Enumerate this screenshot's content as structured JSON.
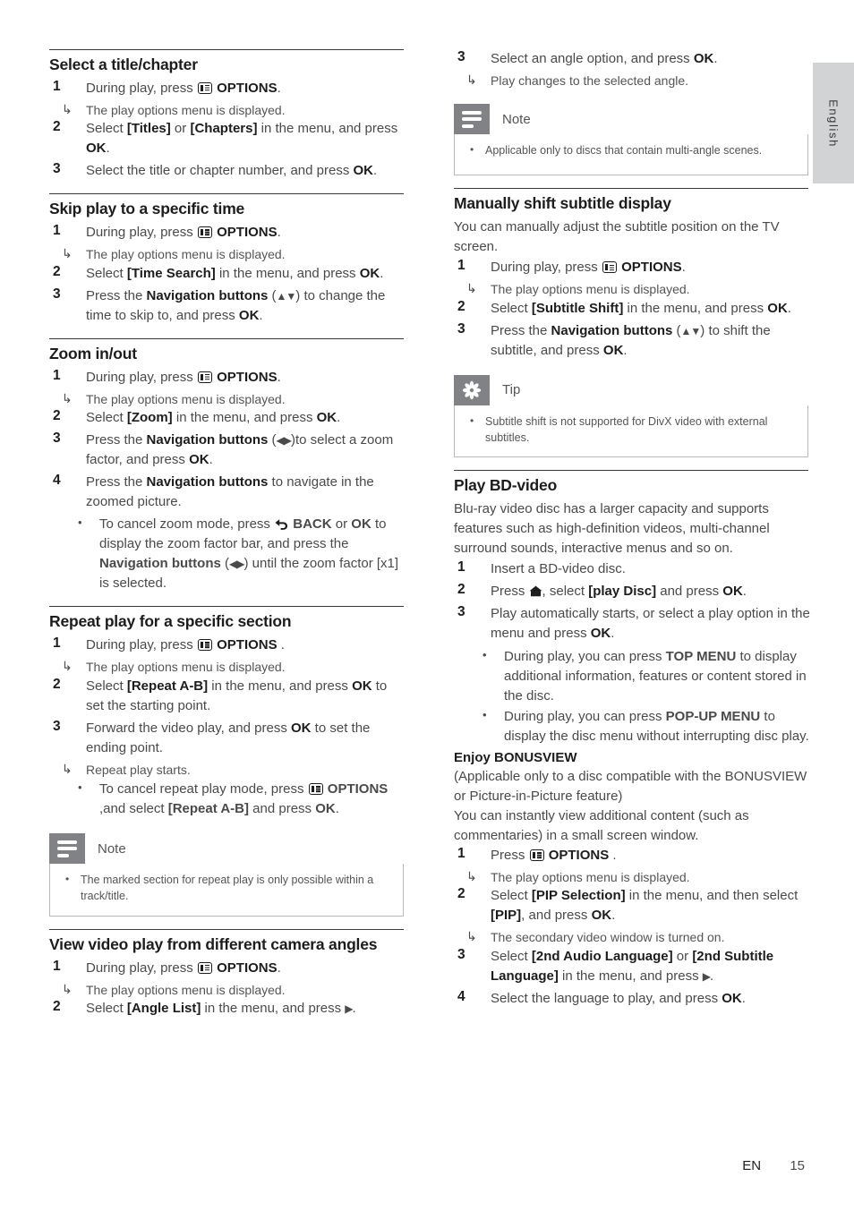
{
  "page": {
    "language_tab": "English",
    "footer": {
      "language_code": "EN",
      "page_number": "15"
    }
  },
  "icons": {
    "options": "options-icon",
    "back": "back-arrow-icon",
    "home": "home-icon",
    "note": "note-icon",
    "tip": "tip-star-icon",
    "nav_up_down": "▲▼",
    "nav_left_right": "◀▶",
    "right_triangle": "▶",
    "result_arrow": "↳",
    "bullet": "•"
  },
  "left_column": {
    "sections": [
      {
        "title": "Select a title/chapter",
        "steps": [
          {
            "num": "1",
            "text_html": "During play, press <span class=\"ico ico-options\" data-name=\"options-icon\" data-interactable=\"false\"></span> <b>OPTIONS</b>.",
            "result": "The play options menu is displayed."
          },
          {
            "num": "2",
            "text_html": "Select <b>[Titles]</b> or <b>[Chapters]</b> in the menu, and press <b>OK</b>."
          },
          {
            "num": "3",
            "text_html": "Select the title or chapter number, and press <b>OK</b>."
          }
        ]
      },
      {
        "title": "Skip play to a specific time",
        "steps": [
          {
            "num": "1",
            "text_html": "During play, press <span class=\"ico ico-options\" data-name=\"options-icon\" data-interactable=\"false\"></span> <b>OPTIONS</b>.",
            "result": "The play options menu is displayed."
          },
          {
            "num": "2",
            "text_html": "Select <b>[Time Search]</b> in the menu, and press <b>OK</b>."
          },
          {
            "num": "3",
            "text_html": "Press the <b>Navigation buttons</b> (<span class=\"ico-tri\">▲▼</span>) to change the time to skip to, and press <b>OK</b>."
          }
        ]
      },
      {
        "title": "Zoom in/out",
        "steps": [
          {
            "num": "1",
            "text_html": "During play, press <span class=\"ico ico-options\" data-name=\"options-icon\" data-interactable=\"false\"></span> <b>OPTIONS</b>.",
            "result": "The play options menu is displayed."
          },
          {
            "num": "2",
            "text_html": "Select <b>[Zoom]</b> in the menu, and press <b>OK</b>."
          },
          {
            "num": "3",
            "text_html": "Press the <b>Navigation buttons</b> (<span class=\"ico-tri\">◀▶</span>)to select a zoom factor, and press <b>OK</b>."
          },
          {
            "num": "4",
            "text_html": "Press the <b>Navigation buttons</b> to navigate in the zoomed picture.",
            "bullets": [
              "To cancel zoom mode, press <span class=\"ico-back\" data-name=\"back-arrow-icon\"></span> <b>BACK</b> or <b>OK</b> to display the zoom factor bar, and press the <b>Navigation buttons</b> (<span class=\"ico-tri\">◀▶</span>) until the zoom factor [x1] is selected."
            ]
          }
        ]
      },
      {
        "title": "Repeat play for a specific section",
        "steps": [
          {
            "num": "1",
            "text_html": "During play, press <span class=\"ico ico-options\" data-name=\"options-icon\" data-interactable=\"false\"></span> <b>OPTIONS</b> .",
            "result": "The play options menu is displayed."
          },
          {
            "num": "2",
            "text_html": "Select <b>[Repeat A-B]</b> in the menu, and press <b>OK</b> to set the starting point."
          },
          {
            "num": "3",
            "text_html": "Forward the video play, and press <b>OK</b> to set the ending point.",
            "result": "Repeat play starts.",
            "bullets": [
              "To cancel repeat play mode, press <span class=\"ico ico-options\"></span> <b>OPTIONS</b> ,and select <b>[Repeat A-B]</b> and press <b>OK</b>."
            ]
          }
        ],
        "callout": {
          "type": "note",
          "label": "Note",
          "items": [
            "The marked section for repeat play is only possible within a track/title."
          ]
        }
      },
      {
        "title": "View video play from different camera angles",
        "steps": [
          {
            "num": "1",
            "text_html": "During play, press <span class=\"ico ico-options\" data-name=\"options-icon\" data-interactable=\"false\"></span> <b>OPTIONS</b>.",
            "result": "The play options menu is displayed."
          },
          {
            "num": "2",
            "text_html": "Select <b>[Angle List]</b> in the menu, and press <span class=\"ico-tri\">▶</span>."
          }
        ]
      }
    ]
  },
  "right_column": {
    "continued_steps": [
      {
        "num": "3",
        "text_html": "Select an angle option, and press <b>OK</b>.",
        "result": "Play changes to the selected angle."
      }
    ],
    "continued_callout": {
      "type": "note",
      "label": "Note",
      "items": [
        "Applicable only to discs that contain multi-angle scenes."
      ]
    },
    "sections": [
      {
        "title": "Manually shift subtitle display",
        "intro": "You can manually adjust the subtitle position on the TV screen.",
        "steps": [
          {
            "num": "1",
            "text_html": "During play, press <span class=\"ico ico-options\" data-name=\"options-icon\" data-interactable=\"false\"></span> <b>OPTIONS</b>.",
            "result": "The play options menu is displayed."
          },
          {
            "num": "2",
            "text_html": " Select <b>[Subtitle Shift]</b> in the menu, and press <b>OK</b>."
          },
          {
            "num": "3",
            "text_html": "Press the <b>Navigation buttons</b> (<span class=\"ico-tri\">▲▼</span>) to shift the subtitle, and press <b>OK</b>."
          }
        ],
        "callout": {
          "type": "tip",
          "label": "Tip",
          "items": [
            "Subtitle shift is not supported for DivX video with external subtitles."
          ]
        }
      },
      {
        "title": "Play BD-video",
        "intro": "Blu-ray video disc has a larger capacity and supports features such as high-definition videos, multi-channel surround sounds, interactive menus and so on.",
        "steps": [
          {
            "num": "1",
            "text_html": "Insert a BD-video disc."
          },
          {
            "num": "2",
            "text_html": "Press <span class=\"ico-home\" data-name=\"home-icon\"></span>, select <b>[play Disc]</b> and press <b>OK</b>."
          },
          {
            "num": "3",
            "text_html": "Play automatically starts, or select a play option in the menu and press <b>OK</b>.",
            "bullets": [
              "During play, you can press <b>TOP MENU</b> to display additional information, features or content stored in the disc.",
              "During play, you can press <b>POP-UP MENU</b> to display the disc menu without interrupting disc play."
            ]
          }
        ],
        "subsection": {
          "title": "Enjoy BONUSVIEW",
          "paragraphs": [
            "(Applicable only to a disc compatible with the BONUSVIEW or Picture-in-Picture feature)",
            "You can instantly view additional content (such as commentaries) in a small screen window."
          ],
          "steps": [
            {
              "num": "1",
              "text_html": "Press <span class=\"ico ico-options\" data-name=\"options-icon\" data-interactable=\"false\"></span> <b>OPTIONS</b> .",
              "result": "The play options menu is displayed."
            },
            {
              "num": "2",
              "text_html": "Select <b>[PIP Selection]</b> in the menu, and then select <b>[PIP]</b>, and press <b>OK</b>.",
              "result": "The secondary video window is turned on."
            },
            {
              "num": "3",
              "text_html": "Select <b>[2nd Audio Language]</b> or <b>[2nd Subtitle Language]</b> in the menu, and press <span class=\"ico-tri\">▶</span>."
            },
            {
              "num": "4",
              "text_html": "Select the language to play, and press <b>OK</b>."
            }
          ]
        }
      }
    ]
  }
}
